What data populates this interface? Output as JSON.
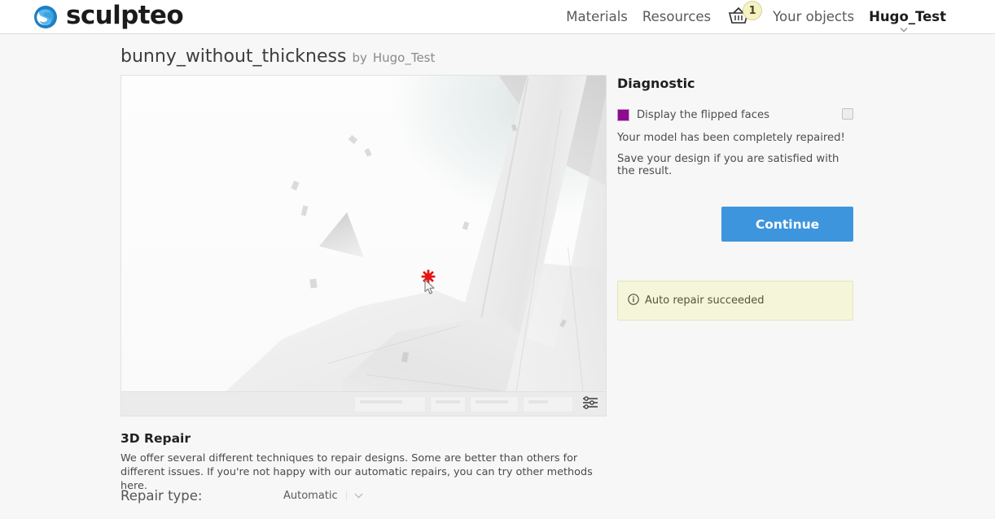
{
  "header": {
    "brand": "sculpteo",
    "brand_icon": "sculpteo-s-logo-icon",
    "nav": [
      {
        "label": "Materials",
        "name": "nav-materials"
      },
      {
        "label": "Resources",
        "name": "nav-resources"
      }
    ],
    "basket": {
      "icon": "basket-icon",
      "count": "1"
    },
    "your_objects": "Your objects",
    "user": "Hugo_Test",
    "user_caret_icon": "chevron-down-icon"
  },
  "title": {
    "model_name": "bunny_without_thickness",
    "by": "by",
    "owner": "Hugo_Test"
  },
  "viewer": {
    "toolbar_settings_icon": "sliders-icon",
    "cursor_icon": "cursor-arrow-icon",
    "click_marker_icon": "click-star-icon"
  },
  "diagnostic": {
    "heading": "Diagnostic",
    "flipped_faces_label": "Display the flipped faces",
    "flipped_faces_swatch_color": "#8e0a8e",
    "flipped_faces_checked": false,
    "status_line_1": "Your model has been completely repaired!",
    "status_line_2": "Save your design if you are satisfied with the result.",
    "continue_label": "Continue",
    "continue_color": "#3d95dd",
    "alert": {
      "icon": "info-circle-icon",
      "text": "Auto repair succeeded",
      "background": "#f5f5da"
    }
  },
  "repair": {
    "heading": "3D Repair",
    "description": "We offer several different techniques to repair designs. Some are better than others for different issues. If you're not happy with our automatic repairs, you can try other methods here.",
    "type_label": "Repair type:",
    "type_value": "Automatic",
    "type_caret_icon": "chevron-down-icon"
  }
}
